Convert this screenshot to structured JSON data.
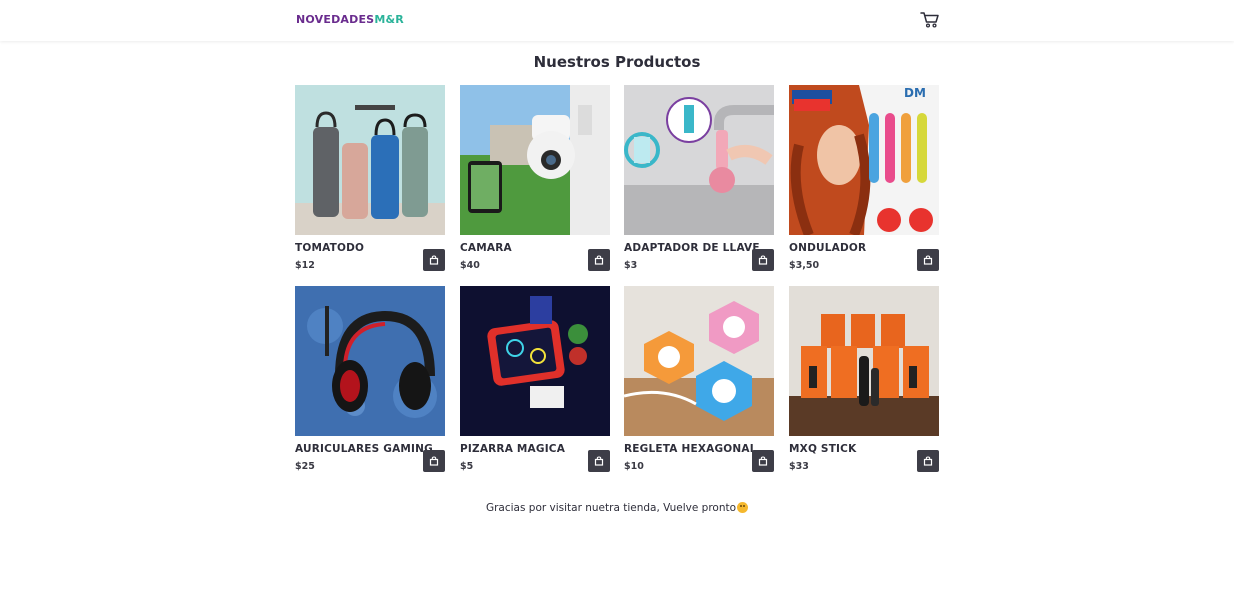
{
  "header": {
    "logo_part1": "NOVEDADES",
    "logo_part2": "M&R",
    "cart_icon": "shopping-cart-icon",
    "colors": {
      "logo_primary": "#6a2c8e",
      "logo_accent": "#2bb39a"
    }
  },
  "main": {
    "title": "Nuestros Productos"
  },
  "products": [
    {
      "name": "TOMATODO",
      "price": "$12",
      "image": "water-bottles"
    },
    {
      "name": "CAMARA",
      "price": "$40",
      "image": "security-camera"
    },
    {
      "name": "ADAPTADOR DE LLAVE",
      "price": "$3",
      "image": "faucet-adapter"
    },
    {
      "name": "ONDULADOR",
      "price": "$3,50",
      "image": "hair-curler"
    },
    {
      "name": "AURICULARES GAMING",
      "price": "$25",
      "image": "gaming-headset"
    },
    {
      "name": "PIZARRA MAGICA",
      "price": "$5",
      "image": "magic-drawing-board"
    },
    {
      "name": "REGLETA HEXAGONAL",
      "price": "$10",
      "image": "hexagonal-power-strip"
    },
    {
      "name": "MXQ STICK",
      "price": "$33",
      "image": "tv-stick"
    }
  ],
  "buy_button": {
    "icon": "shopping-bag-icon",
    "color": "#3d3d47"
  },
  "footer": {
    "text": "Gracias por visitar nuetra tienda, Vuelve pronto",
    "emoji_icon": "smiley-face-icon"
  }
}
